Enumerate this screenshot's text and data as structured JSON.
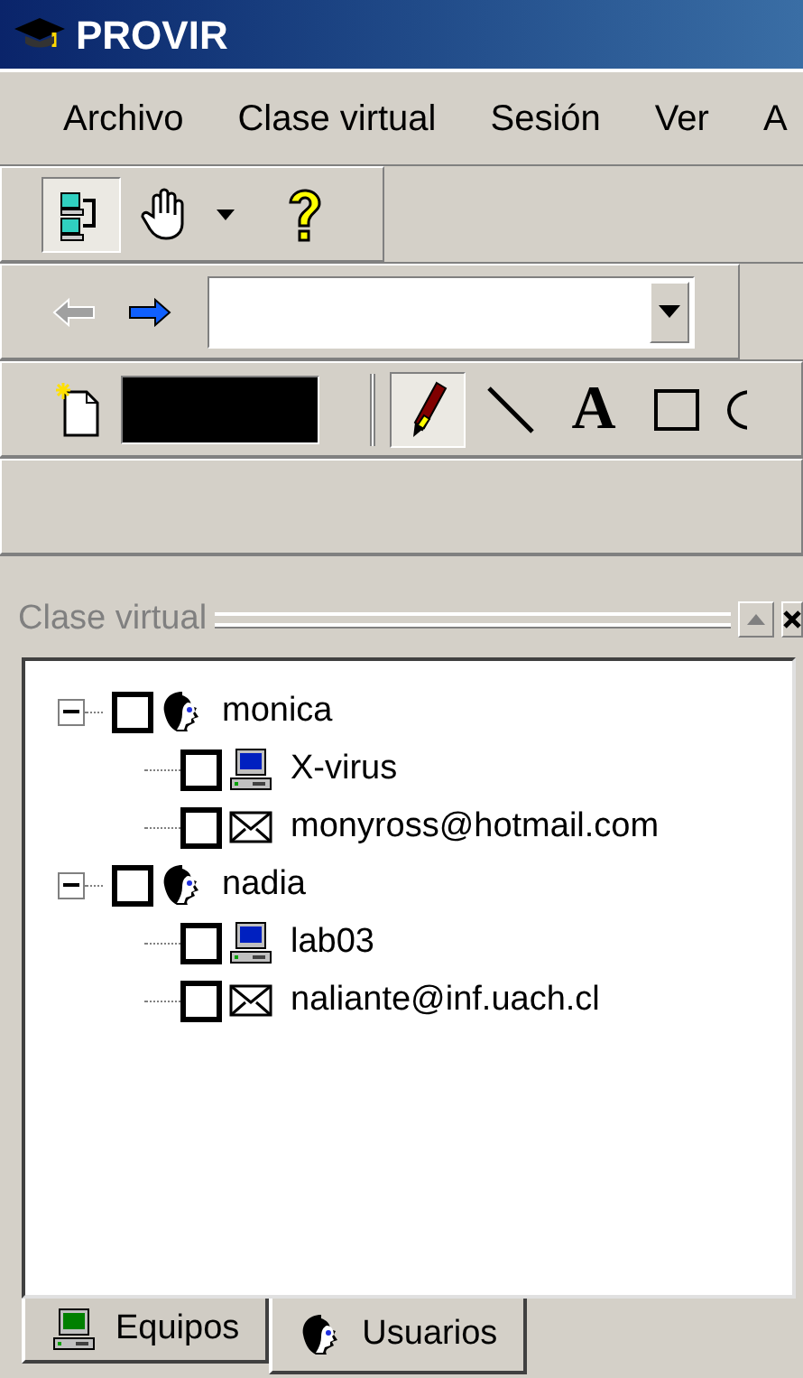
{
  "window": {
    "title": "PROVIR"
  },
  "menu": [
    "Archivo",
    "Clase virtual",
    "Sesión",
    "Ver",
    "A"
  ],
  "toolbar_1": [
    {
      "kind": "network",
      "pressed": true
    },
    {
      "kind": "hand",
      "pressed": false
    },
    {
      "kind": "dropdown",
      "pressed": false
    },
    {
      "kind": "help",
      "pressed": false
    }
  ],
  "toolbar_2": {
    "back": {
      "disabled": true
    },
    "forward": {
      "disabled": false
    }
  },
  "toolbar_3": {
    "color": "#000000",
    "tools": [
      {
        "kind": "pencil",
        "pressed": true
      },
      {
        "kind": "line",
        "pressed": false
      },
      {
        "kind": "text",
        "glyph": "A",
        "pressed": false
      },
      {
        "kind": "rectangle",
        "pressed": false
      },
      {
        "kind": "ellipse",
        "pressed": false
      }
    ]
  },
  "pane": {
    "title": "Clase virtual",
    "tree": [
      {
        "kind": "user",
        "label": "monica",
        "checked": false,
        "expanded": true,
        "children": [
          {
            "kind": "computer",
            "label": "X-virus",
            "checked": false
          },
          {
            "kind": "email",
            "label": "monyross@hotmail.com",
            "checked": false
          }
        ]
      },
      {
        "kind": "user",
        "label": "nadia",
        "checked": false,
        "expanded": true,
        "children": [
          {
            "kind": "computer",
            "label": "lab03",
            "checked": false
          },
          {
            "kind": "email",
            "label": "naliante@inf.uach.cl",
            "checked": false
          }
        ]
      }
    ]
  },
  "tabs": [
    {
      "kind": "computer",
      "label": "Equipos",
      "selected": false
    },
    {
      "kind": "user",
      "label": "Usuarios",
      "selected": true
    }
  ]
}
